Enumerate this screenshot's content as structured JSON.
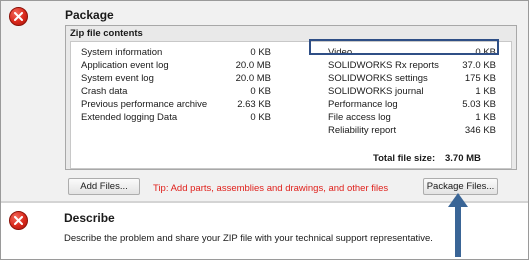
{
  "package": {
    "title": "Package",
    "zip_title": "Zip file contents",
    "left_items": [
      {
        "label": "System information",
        "size": "0 KB"
      },
      {
        "label": "Application event log",
        "size": "20.0 MB"
      },
      {
        "label": "System event log",
        "size": "20.0 MB"
      },
      {
        "label": "Crash data",
        "size": "0 KB"
      },
      {
        "label": "Previous performance archive",
        "size": "2.63 KB"
      },
      {
        "label": "Extended logging Data",
        "size": "0 KB"
      }
    ],
    "right_items": [
      {
        "label": "Video",
        "size": "0 KB"
      },
      {
        "label": "SOLIDWORKS Rx reports",
        "size": "37.0 KB"
      },
      {
        "label": "SOLIDWORKS settings",
        "size": "175 KB"
      },
      {
        "label": "SOLIDWORKS journal",
        "size": "1 KB"
      },
      {
        "label": "Performance log",
        "size": "5.03 KB"
      },
      {
        "label": "File access log",
        "size": "1 KB"
      },
      {
        "label": "Reliability report",
        "size": "346 KB"
      }
    ],
    "total_label": "Total file size:",
    "total_value": "3.70 MB",
    "add_files_label": "Add Files...",
    "tip_text": "Tip: Add parts, assemblies and drawings, and other files",
    "package_files_label": "Package Files..."
  },
  "describe": {
    "title": "Describe",
    "text": "Describe the problem and share your ZIP file with your technical support representative."
  },
  "colors": {
    "error_red": "#d9281b",
    "tip_red": "#e0201b",
    "highlight_blue": "#2f4f86",
    "arrow_blue": "#3a6596"
  },
  "icons": [
    "error-icon",
    "up-arrow-icon"
  ]
}
